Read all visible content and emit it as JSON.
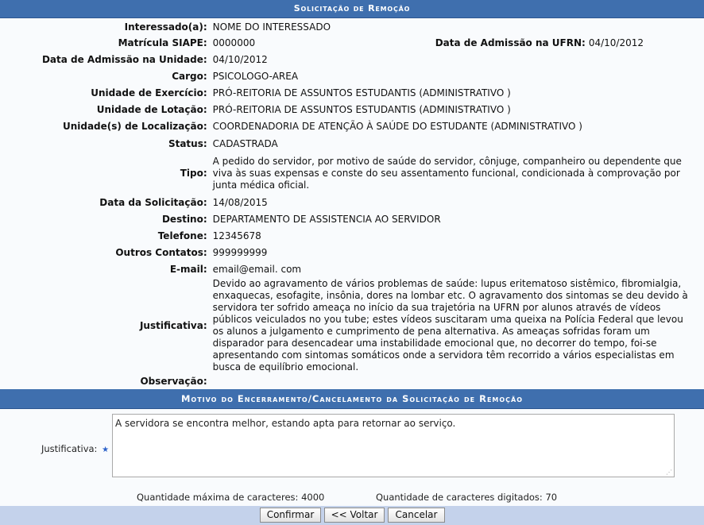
{
  "section1": {
    "title": "Solicitação de Remoção",
    "fields": {
      "interessado": {
        "label": "Interessado(a):",
        "value": "NOME DO INTERESSADO"
      },
      "matricula": {
        "label": "Matrícula SIAPE:",
        "value": "0000000"
      },
      "admissao_ufrn": {
        "label": "Data de Admissão na UFRN:",
        "value": "04/10/2012"
      },
      "admissao_unidade": {
        "label": "Data de Admissão na Unidade:",
        "value": "04/10/2012"
      },
      "cargo": {
        "label": "Cargo:",
        "value": "PSICOLOGO-AREA"
      },
      "unidade_exercicio": {
        "label": "Unidade de Exercício:",
        "value": "PRÓ-REITORIA DE ASSUNTOS ESTUDANTIS (ADMINISTRATIVO )"
      },
      "unidade_lotacao": {
        "label": "Unidade de Lotação:",
        "value": "PRÓ-REITORIA DE ASSUNTOS ESTUDANTIS (ADMINISTRATIVO )"
      },
      "unidade_localizacao": {
        "label": "Unidade(s) de Localização:",
        "value": "COORDENADORIA DE ATENÇÃO À SAÚDE DO ESTUDANTE (ADMINISTRATIVO )"
      },
      "status": {
        "label": "Status:",
        "value": "CADASTRADA"
      },
      "tipo": {
        "label": "Tipo:",
        "value": "A pedido do servidor, por motivo de saúde do servidor, cônjuge, companheiro ou dependente que viva às suas expensas e conste do seu assentamento funcional, condicionada à comprovação por junta médica oficial."
      },
      "data_solicitacao": {
        "label": "Data da Solicitação:",
        "value": "14/08/2015"
      },
      "destino": {
        "label": "Destino:",
        "value": "DEPARTAMENTO DE ASSISTENCIA AO SERVIDOR"
      },
      "telefone": {
        "label": "Telefone:",
        "value": "12345678"
      },
      "outros_contatos": {
        "label": "Outros Contatos:",
        "value": "999999999"
      },
      "email": {
        "label": "E-mail:",
        "value": "email@email. com"
      },
      "justificativa": {
        "label": "Justificativa:",
        "value": "Devido ao agravamento de vários problemas de saúde: lupus eritematoso sistêmico, fibromialgia, enxaquecas, esofagite, insônia, dores na lombar etc. O agravamento dos sintomas se deu devido à servidora ter sofrido ameaça no início da sua trajetória na UFRN por alunos através de vídeos públicos veiculados no you tube; estes vídeos suscitaram uma queixa na Polícia Federal que levou os alunos a julgamento e cumprimento de pena alternativa. As ameaças sofridas foram um disparador para desencadear uma instabilidade emocional que, no decorrer do tempo, foi-se apresentando com sintomas somáticos onde a servidora têm recorrido a vários especialistas em busca de equilíbrio emocional."
      },
      "observacao": {
        "label": "Observação:",
        "value": ""
      }
    }
  },
  "section2": {
    "title": "Motivo do Encerramento/Cancelamento da Solicitação de Remoção",
    "justificativa_label": "Justificativa:",
    "required_star": "★",
    "justificativa_value": "A servidora se encontra melhor, estando apta para retornar ao serviço.",
    "max_chars_text": "Quantidade máxima de caracteres: 4000",
    "typed_chars_text": "Quantidade de caracteres digitados: 70"
  },
  "buttons": {
    "confirmar": "Confirmar",
    "voltar": "<< Voltar",
    "cancelar": "Cancelar"
  },
  "colors": {
    "header_bg": "#3f6fae",
    "button_bar_bg": "#c4d2eb",
    "required_star": "#2b61c9"
  }
}
